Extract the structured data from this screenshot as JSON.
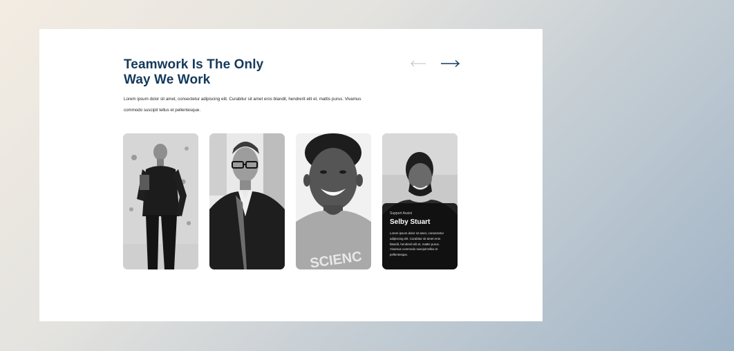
{
  "section": {
    "title_line1": "Teamwork Is The Only",
    "title_line2": "Way We Work",
    "description": "Lorem ipsum dolor sit amet, consectetur adipiscing elit. Curabitur sit amet eros blandit, hendrerit elit et, mattis purus. Vivamus commodo suscipit tellus et pellentesque."
  },
  "navigation": {
    "prev_icon": "arrow-left-icon",
    "next_icon": "arrow-right-icon",
    "inactive_color": "#b8c0c8",
    "active_color": "#14395b"
  },
  "team": [
    {
      "photo": "team-member-1-photo"
    },
    {
      "photo": "team-member-2-photo"
    },
    {
      "photo": "team-member-3-photo"
    },
    {
      "photo": "team-member-4-photo",
      "role": "Support Assist",
      "name": "Selby Stuart",
      "bio": "Lorem ipsum dolor sit amet, consectetur adipiscing elit. Curabitur sit amet eros blandit, hendrerit elit et, mattis purus. Vivamus commodo suscipit tellus et pellentesque."
    }
  ],
  "colors": {
    "heading": "#14395b",
    "overlay": "#0e0e0e",
    "frame": "#ffffff"
  }
}
